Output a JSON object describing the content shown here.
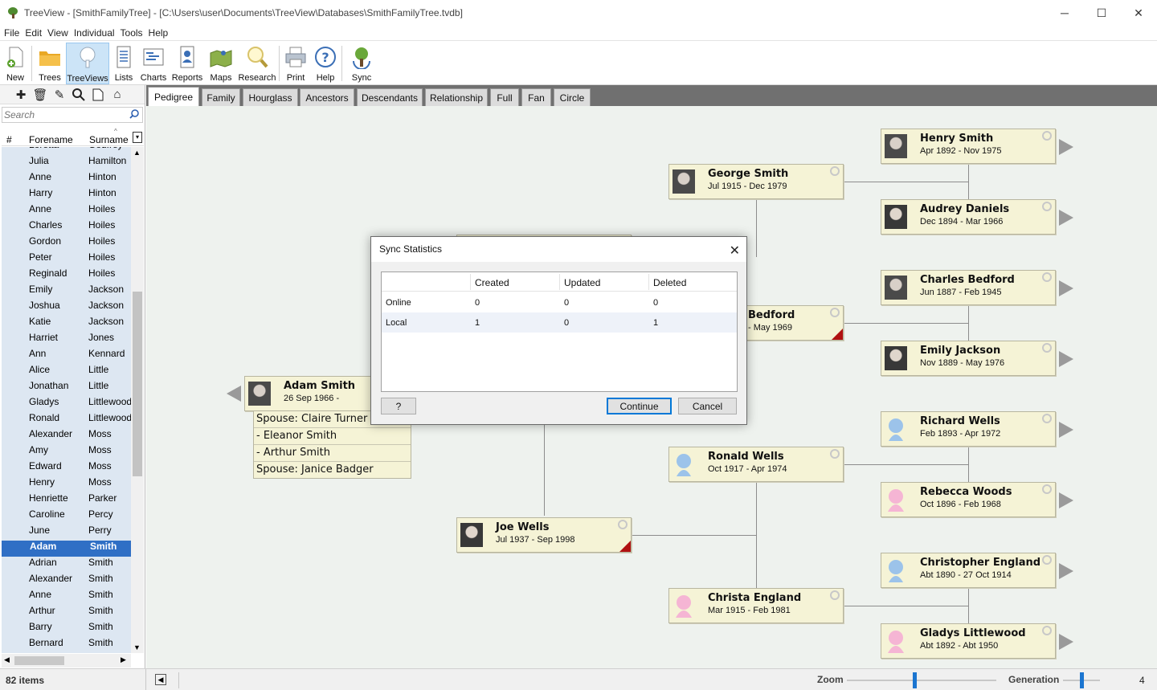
{
  "window": {
    "title": "TreeView - [SmithFamilyTree] - [C:\\Users\\user\\Documents\\TreeView\\Databases\\SmithFamilyTree.tvdb]",
    "minimize": "─",
    "maximize": "☐",
    "close": "✕"
  },
  "menu": [
    "File",
    "Edit",
    "View",
    "Individual",
    "Tools",
    "Help"
  ],
  "toolbar": {
    "new": "New",
    "trees": "Trees",
    "treeviews": "TreeViews",
    "lists": "Lists",
    "charts": "Charts",
    "reports": "Reports",
    "maps": "Maps",
    "research": "Research",
    "print": "Print",
    "help": "Help",
    "sync": "Sync"
  },
  "left_panel": {
    "search_placeholder": "Search",
    "col_num": "#",
    "col_forename": "Forename",
    "col_surname": "Surname",
    "rows": [
      [
        "Loretta",
        "Godfrey"
      ],
      [
        "Julia",
        "Hamilton"
      ],
      [
        "Anne",
        "Hinton"
      ],
      [
        "Harry",
        "Hinton"
      ],
      [
        "Anne",
        "Hoiles"
      ],
      [
        "Charles",
        "Hoiles"
      ],
      [
        "Gordon",
        "Hoiles"
      ],
      [
        "Peter",
        "Hoiles"
      ],
      [
        "Reginald",
        "Hoiles"
      ],
      [
        "Emily",
        "Jackson"
      ],
      [
        "Joshua",
        "Jackson"
      ],
      [
        "Katie",
        "Jackson"
      ],
      [
        "Harriet",
        "Jones"
      ],
      [
        "Ann",
        "Kennard"
      ],
      [
        "Alice",
        "Little"
      ],
      [
        "Jonathan",
        "Little"
      ],
      [
        "Gladys",
        "Littlewood"
      ],
      [
        "Ronald",
        "Littlewood"
      ],
      [
        "Alexander",
        "Moss"
      ],
      [
        "Amy",
        "Moss"
      ],
      [
        "Edward",
        "Moss"
      ],
      [
        "Henry",
        "Moss"
      ],
      [
        "Henriette",
        "Parker"
      ],
      [
        "Caroline",
        "Percy"
      ],
      [
        "June",
        "Perry"
      ],
      [
        "Adam",
        "Smith"
      ],
      [
        "Adrian",
        "Smith"
      ],
      [
        "Alexander",
        "Smith"
      ],
      [
        "Anne",
        "Smith"
      ],
      [
        "Arthur",
        "Smith"
      ],
      [
        "Barry",
        "Smith"
      ],
      [
        "Bernard",
        "Smith"
      ]
    ],
    "selected_index": 25
  },
  "tabs": [
    "Pedigree",
    "Family",
    "Hourglass",
    "Ancestors",
    "Descendants",
    "Relationship",
    "Full",
    "Fan",
    "Circle"
  ],
  "active_tab": "Pedigree",
  "people": {
    "adam": {
      "name": "Adam Smith",
      "dates": "26 Sep 1966 -"
    },
    "george": {
      "name": "George Smith",
      "dates": "Jul 1915 - Dec 1979"
    },
    "bedford": {
      "name": "Bedford",
      "dates": "- May 1969"
    },
    "joe": {
      "name": "Joe Wells",
      "dates": "Jul 1937 - Sep 1998"
    },
    "ronald": {
      "name": "Ronald Wells",
      "dates": "Oct 1917 - Apr 1974"
    },
    "christa": {
      "name": "Christa England",
      "dates": "Mar 1915 - Feb 1981"
    },
    "henry": {
      "name": "Henry Smith",
      "dates": "Apr 1892 - Nov 1975"
    },
    "audrey": {
      "name": "Audrey Daniels",
      "dates": "Dec 1894 - Mar 1966"
    },
    "charles": {
      "name": "Charles Bedford",
      "dates": "Jun 1887 - Feb 1945"
    },
    "emily": {
      "name": "Emily Jackson",
      "dates": "Nov 1889 - May 1976"
    },
    "richard": {
      "name": "Richard Wells",
      "dates": "Feb 1893 - Apr 1972"
    },
    "rebecca": {
      "name": "Rebecca Woods",
      "dates": "Oct 1896 - Feb 1968"
    },
    "christopher": {
      "name": "Christopher England",
      "dates": "Abt 1890 - 27 Oct 1914"
    },
    "gladys": {
      "name": "Gladys Littlewood",
      "dates": "Abt 1892 - Abt 1950"
    }
  },
  "spouses": [
    "Spouse: Claire Turner",
    " - Eleanor Smith",
    " - Arthur Smith",
    "Spouse: Janice Badger"
  ],
  "dialog": {
    "title": "Sync Statistics",
    "close": "✕",
    "columns": [
      "",
      "Created",
      "Updated",
      "Deleted"
    ],
    "rows": [
      {
        "label": "Online",
        "created": "0",
        "updated": "0",
        "deleted": "0"
      },
      {
        "label": "Local",
        "created": "1",
        "updated": "0",
        "deleted": "1"
      }
    ],
    "help_button": "?",
    "continue_button": "Continue",
    "cancel_button": "Cancel"
  },
  "status": {
    "count": "82 items",
    "zoom_label": "Zoom",
    "generation_label": "Generation",
    "generation_value": "4",
    "zoom_level": 0.45,
    "generation_level": 0.5
  },
  "colors": {
    "selection": "#2f6fc5",
    "card_fill": "#f5f3d6",
    "tab_bar": "#707070",
    "accent": "#0078d7"
  }
}
